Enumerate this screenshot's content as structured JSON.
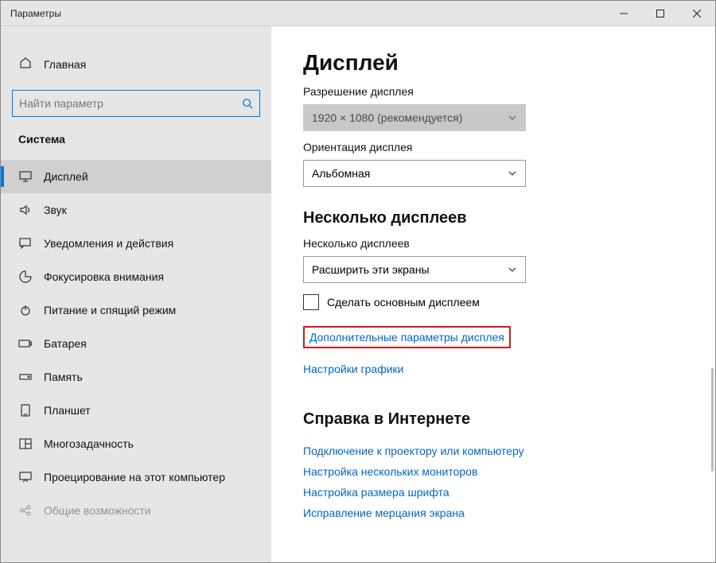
{
  "titlebar": {
    "title": "Параметры"
  },
  "sidebar": {
    "home": "Главная",
    "search_placeholder": "Найти параметр",
    "category": "Система",
    "items": [
      {
        "label": "Дисплей",
        "icon": "display-icon",
        "active": true
      },
      {
        "label": "Звук",
        "icon": "sound-icon"
      },
      {
        "label": "Уведомления и действия",
        "icon": "notifications-icon"
      },
      {
        "label": "Фокусировка внимания",
        "icon": "focus-icon"
      },
      {
        "label": "Питание и спящий режим",
        "icon": "power-icon"
      },
      {
        "label": "Батарея",
        "icon": "battery-icon"
      },
      {
        "label": "Память",
        "icon": "storage-icon"
      },
      {
        "label": "Планшет",
        "icon": "tablet-icon"
      },
      {
        "label": "Многозадачность",
        "icon": "multitask-icon"
      },
      {
        "label": "Проецирование на этот компьютер",
        "icon": "projecting-icon"
      },
      {
        "label": "Общие возможности",
        "icon": "shared-icon"
      }
    ]
  },
  "main": {
    "title": "Дисплей",
    "resolution_label": "Разрешение дисплея",
    "resolution_value": "1920 × 1080 (рекомендуется)",
    "orientation_label": "Ориентация дисплея",
    "orientation_value": "Альбомная",
    "multi_heading": "Несколько дисплеев",
    "multi_label": "Несколько дисплеев",
    "multi_value": "Расширить эти экраны",
    "primary_checkbox": "Сделать основным дисплеем",
    "advanced_link": "Дополнительные параметры дисплея",
    "graphics_link": "Настройки графики",
    "help_heading": "Справка в Интернете",
    "help_links": [
      "Подключение к проектору или компьютеру",
      "Настройка нескольких мониторов",
      "Настройка размера шрифта",
      "Исправление мерцания экрана"
    ]
  }
}
